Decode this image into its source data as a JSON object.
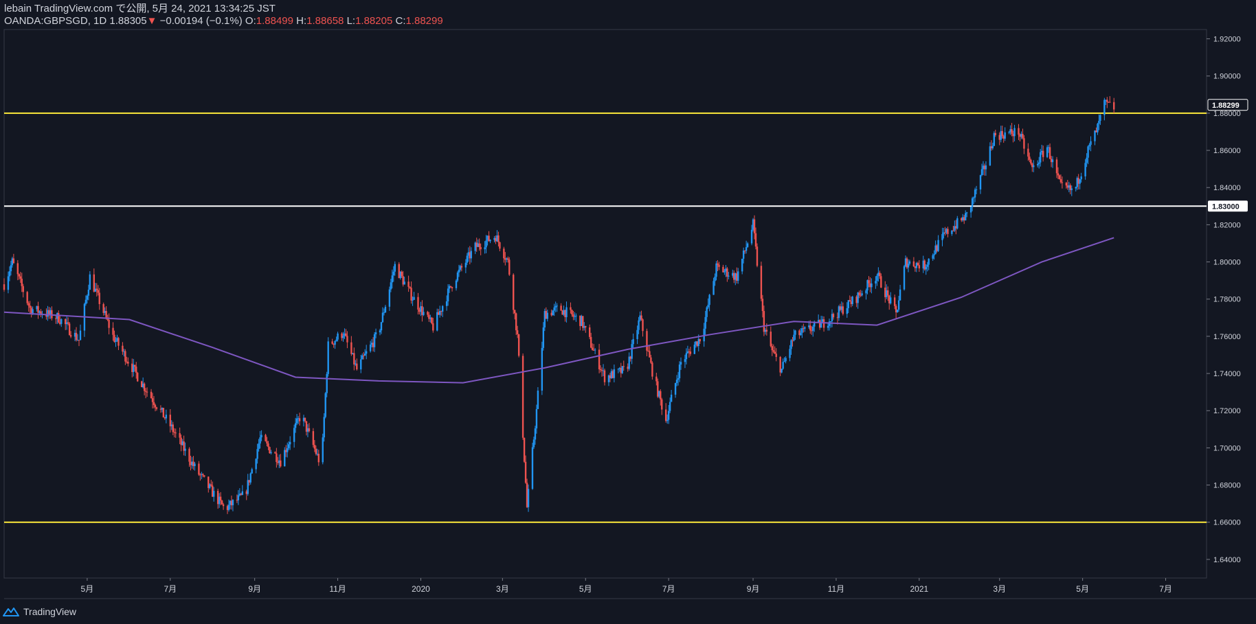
{
  "header": {
    "publisher": "lebain TradingView.com で公開, 5月 24, 2021 13:34:25 JST",
    "symbol": "OANDA:GBPSGD, 1D",
    "last": "1.88305",
    "arrow": "▼",
    "change": "−0.00194 (−0.1%)",
    "o_label": "O:",
    "o_value": "1.88499",
    "h_label": "H:",
    "h_value": "1.88658",
    "l_label": "L:",
    "l_value": "1.88205",
    "c_label": "C:",
    "c_value": "1.88299"
  },
  "footer": {
    "brand": "TradingView",
    "logo_icon": "tradingview-logo-icon"
  },
  "colors": {
    "background": "#131722",
    "up": "#2196f3",
    "down": "#ef5350",
    "ma": "#7e57c2",
    "hline_yellow": "#ffeb3b",
    "hline_white": "#ffffff",
    "axis_text": "#d1d4dc"
  },
  "chart_data": {
    "type": "candlestick",
    "symbol": "OANDA:GBPSGD",
    "interval": "1D",
    "x_start": "2019-03-01",
    "x_end": "2021-07-31",
    "x_tick_labels": [
      {
        "date": "2019-05-01",
        "label": "5月"
      },
      {
        "date": "2019-07-01",
        "label": "7月"
      },
      {
        "date": "2019-09-01",
        "label": "9月"
      },
      {
        "date": "2019-11-01",
        "label": "11月"
      },
      {
        "date": "2020-01-01",
        "label": "2020"
      },
      {
        "date": "2020-03-01",
        "label": "3月"
      },
      {
        "date": "2020-05-01",
        "label": "5月"
      },
      {
        "date": "2020-07-01",
        "label": "7月"
      },
      {
        "date": "2020-09-01",
        "label": "9月"
      },
      {
        "date": "2020-11-01",
        "label": "11月"
      },
      {
        "date": "2021-01-01",
        "label": "2021"
      },
      {
        "date": "2021-03-01",
        "label": "3月"
      },
      {
        "date": "2021-05-01",
        "label": "5月"
      },
      {
        "date": "2021-07-01",
        "label": "7月"
      }
    ],
    "ylim": [
      1.63,
      1.925
    ],
    "y_ticks": [
      "1.64000",
      "1.66000",
      "1.68000",
      "1.70000",
      "1.72000",
      "1.74000",
      "1.76000",
      "1.78000",
      "1.80000",
      "1.82000",
      "1.84000",
      "1.86000",
      "1.88000",
      "1.90000",
      "1.92000"
    ],
    "price_path": [
      {
        "date": "2019-03-01",
        "close": 1.788
      },
      {
        "date": "2019-03-07",
        "close": 1.8
      },
      {
        "date": "2019-03-20",
        "close": 1.775
      },
      {
        "date": "2019-04-10",
        "close": 1.77
      },
      {
        "date": "2019-04-25",
        "close": 1.758
      },
      {
        "date": "2019-05-03",
        "close": 1.792
      },
      {
        "date": "2019-05-20",
        "close": 1.76
      },
      {
        "date": "2019-06-10",
        "close": 1.735
      },
      {
        "date": "2019-07-01",
        "close": 1.712
      },
      {
        "date": "2019-07-20",
        "close": 1.688
      },
      {
        "date": "2019-08-10",
        "close": 1.667
      },
      {
        "date": "2019-08-25",
        "close": 1.675
      },
      {
        "date": "2019-09-05",
        "close": 1.705
      },
      {
        "date": "2019-09-20",
        "close": 1.693
      },
      {
        "date": "2019-10-05",
        "close": 1.718
      },
      {
        "date": "2019-10-20",
        "close": 1.69
      },
      {
        "date": "2019-10-25",
        "close": 1.755
      },
      {
        "date": "2019-11-05",
        "close": 1.762
      },
      {
        "date": "2019-11-15",
        "close": 1.742
      },
      {
        "date": "2019-12-01",
        "close": 1.762
      },
      {
        "date": "2019-12-13",
        "close": 1.798
      },
      {
        "date": "2019-12-25",
        "close": 1.782
      },
      {
        "date": "2020-01-10",
        "close": 1.765
      },
      {
        "date": "2020-01-25",
        "close": 1.79
      },
      {
        "date": "2020-02-10",
        "close": 1.808
      },
      {
        "date": "2020-02-25",
        "close": 1.814
      },
      {
        "date": "2020-03-05",
        "close": 1.8
      },
      {
        "date": "2020-03-12",
        "close": 1.76
      },
      {
        "date": "2020-03-19",
        "close": 1.668
      },
      {
        "date": "2020-03-26",
        "close": 1.72
      },
      {
        "date": "2020-04-01",
        "close": 1.772
      },
      {
        "date": "2020-04-12",
        "close": 1.775
      },
      {
        "date": "2020-04-28",
        "close": 1.768
      },
      {
        "date": "2020-05-15",
        "close": 1.738
      },
      {
        "date": "2020-05-31",
        "close": 1.742
      },
      {
        "date": "2020-06-10",
        "close": 1.77
      },
      {
        "date": "2020-06-20",
        "close": 1.738
      },
      {
        "date": "2020-06-29",
        "close": 1.715
      },
      {
        "date": "2020-07-10",
        "close": 1.746
      },
      {
        "date": "2020-07-25",
        "close": 1.76
      },
      {
        "date": "2020-08-05",
        "close": 1.797
      },
      {
        "date": "2020-08-20",
        "close": 1.792
      },
      {
        "date": "2020-09-01",
        "close": 1.82
      },
      {
        "date": "2020-09-09",
        "close": 1.765
      },
      {
        "date": "2020-09-15",
        "close": 1.752
      },
      {
        "date": "2020-09-22",
        "close": 1.742
      },
      {
        "date": "2020-10-01",
        "close": 1.76
      },
      {
        "date": "2020-10-25",
        "close": 1.768
      },
      {
        "date": "2020-11-15",
        "close": 1.78
      },
      {
        "date": "2020-12-01",
        "close": 1.793
      },
      {
        "date": "2020-12-15",
        "close": 1.772
      },
      {
        "date": "2020-12-22",
        "close": 1.8
      },
      {
        "date": "2021-01-05",
        "close": 1.798
      },
      {
        "date": "2021-01-20",
        "close": 1.815
      },
      {
        "date": "2021-02-05",
        "close": 1.825
      },
      {
        "date": "2021-02-20",
        "close": 1.855
      },
      {
        "date": "2021-02-25",
        "close": 1.868
      },
      {
        "date": "2021-03-15",
        "close": 1.87
      },
      {
        "date": "2021-03-25",
        "close": 1.85
      },
      {
        "date": "2021-04-05",
        "close": 1.862
      },
      {
        "date": "2021-04-15",
        "close": 1.84
      },
      {
        "date": "2021-04-25",
        "close": 1.838
      },
      {
        "date": "2021-05-05",
        "close": 1.86
      },
      {
        "date": "2021-05-12",
        "close": 1.872
      },
      {
        "date": "2021-05-17",
        "close": 1.885
      },
      {
        "date": "2021-05-24",
        "close": 1.883
      }
    ],
    "moving_average": {
      "color": "#7e57c2",
      "points": [
        {
          "date": "2019-03-01",
          "value": 1.773
        },
        {
          "date": "2019-06-01",
          "value": 1.769
        },
        {
          "date": "2019-08-01",
          "value": 1.754
        },
        {
          "date": "2019-10-01",
          "value": 1.738
        },
        {
          "date": "2019-12-01",
          "value": 1.736
        },
        {
          "date": "2020-02-01",
          "value": 1.735
        },
        {
          "date": "2020-04-01",
          "value": 1.743
        },
        {
          "date": "2020-06-01",
          "value": 1.753
        },
        {
          "date": "2020-08-01",
          "value": 1.761
        },
        {
          "date": "2020-10-01",
          "value": 1.768
        },
        {
          "date": "2020-12-01",
          "value": 1.766
        },
        {
          "date": "2021-02-01",
          "value": 1.781
        },
        {
          "date": "2021-04-01",
          "value": 1.8
        },
        {
          "date": "2021-05-24",
          "value": 1.813
        }
      ]
    },
    "horizontal_lines": [
      {
        "price": 1.88,
        "color": "#ffeb3b"
      },
      {
        "price": 1.83,
        "color": "#ffffff",
        "label": "1.83000"
      },
      {
        "price": 1.66,
        "color": "#ffeb3b"
      }
    ],
    "last_price_label": "1.88299",
    "last_price": 1.88299,
    "grid": false
  }
}
